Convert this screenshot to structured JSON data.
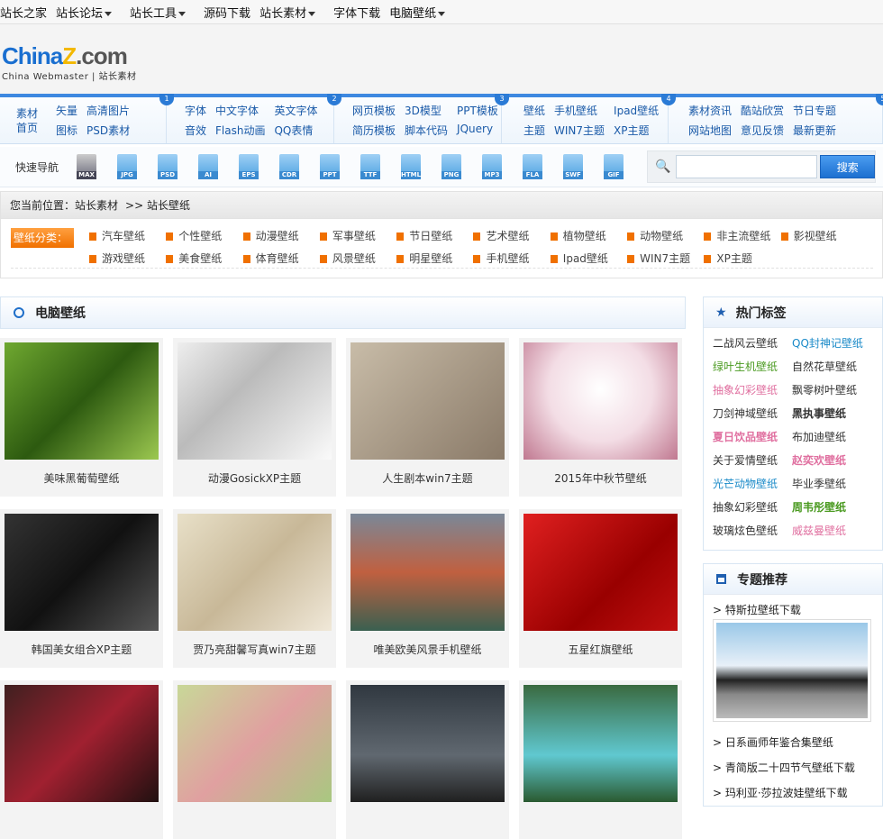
{
  "topnav": [
    "站长之家",
    "站长论坛",
    "站长工具",
    "源码下载",
    "站长素材",
    "字体下载",
    "电脑壁纸"
  ],
  "topnav_dropdown": [
    false,
    true,
    true,
    false,
    true,
    false,
    true
  ],
  "logo": {
    "text": "ChinaZ.com",
    "sub": "China Webmaster | 站长素材"
  },
  "nav_groups": [
    {
      "num": "1",
      "links": [
        "素材首页"
      ],
      "extra": [
        "矢量",
        "高清图片",
        "图标",
        "PSD素材"
      ]
    },
    {
      "num": "2",
      "links": [
        "字体",
        "中文字体",
        "英文字体",
        "音效",
        "Flash动画",
        "QQ表情"
      ]
    },
    {
      "num": "3",
      "links": [
        "网页模板",
        "3D模型",
        "PPT模板",
        "简历模板",
        "脚本代码",
        "JQuery"
      ]
    },
    {
      "num": "4",
      "links": [
        "壁纸",
        "手机壁纸",
        "Ipad壁纸",
        "主题",
        "WIN7主题",
        "XP主题"
      ]
    },
    {
      "num": "5",
      "links": [
        "素材资讯",
        "酷站欣赏",
        "节日专题",
        "网站地图",
        "意见反馈",
        "最新更新"
      ]
    }
  ],
  "quick": {
    "label": "快速导航",
    "icons": [
      "MAX",
      "JPG",
      "PSD",
      "AI",
      "EPS",
      "CDR",
      "PPT",
      "TTF",
      "HTML",
      "PNG",
      "MP3",
      "FLA",
      "SWF",
      "GIF"
    ],
    "search_placeholder": "",
    "search_button": "搜索"
  },
  "breadcrumb": {
    "prefix": "您当前位置：",
    "items": [
      "站长素材",
      ">> 站长壁纸"
    ]
  },
  "categories": {
    "label": "壁纸分类：",
    "items": [
      "汽车壁纸",
      "个性壁纸",
      "动漫壁纸",
      "军事壁纸",
      "节日壁纸",
      "艺术壁纸",
      "植物壁纸",
      "动物壁纸",
      "非主流壁纸",
      "影视壁纸",
      "游戏壁纸",
      "美食壁纸",
      "体育壁纸",
      "风景壁纸",
      "明星壁纸",
      "手机壁纸",
      "Ipad壁纸",
      "WIN7主题",
      "XP主题"
    ]
  },
  "section_title": "电脑壁纸",
  "cards": [
    {
      "title": "美味黑葡萄壁纸",
      "bg": "linear-gradient(135deg,#6fa830,#2d5a10 50%,#9cc850)"
    },
    {
      "title": "动漫GosickXP主题",
      "bg": "linear-gradient(135deg,#eee,#bbb 40%,#fafafa)"
    },
    {
      "title": "人生剧本win7主题",
      "bg": "linear-gradient(135deg,#c8bca8,#8a7a68)"
    },
    {
      "title": "2015年中秋节壁纸",
      "bg": "radial-gradient(circle at 50% 40%,#fff,#f3dde5 50%,#c07890)"
    },
    {
      "title": "韩国美女组合XP主题",
      "bg": "linear-gradient(135deg,#333,#111 50%,#555)"
    },
    {
      "title": "贾乃亮甜馨写真win7主题",
      "bg": "linear-gradient(135deg,#e8e0c8,#c8b898 50%,#f0e8d8)"
    },
    {
      "title": "唯美欧美风景手机壁纸",
      "bg": "linear-gradient(#7a8898,#c06040 50%,#3a6050)"
    },
    {
      "title": "五星红旗壁纸",
      "bg": "linear-gradient(135deg,#e02020,#900 60%,#c01010)"
    },
    {
      "title": "",
      "bg": "linear-gradient(135deg,#402020,#a02030 50%,#201010)"
    },
    {
      "title": "",
      "bg": "linear-gradient(135deg,#c8d898,#e0a0a0 50%,#a8c880)"
    },
    {
      "title": "",
      "bg": "linear-gradient(#303840,#606870 60%,#202020)"
    },
    {
      "title": "",
      "bg": "linear-gradient(#3a6a40,#60c8d0 60%,#2a5a30)"
    }
  ],
  "hot_tags": {
    "title": "热门标签",
    "items": [
      {
        "t": "二战风云壁纸",
        "c": "#333",
        "b": false
      },
      {
        "t": "QQ封神记壁纸",
        "c": "#1a8ac8",
        "b": false
      },
      {
        "t": "绿叶生机壁纸",
        "c": "#4a9a20",
        "b": false
      },
      {
        "t": "自然花草壁纸",
        "c": "#333",
        "b": false
      },
      {
        "t": "抽象幻彩壁纸",
        "c": "#e070a0",
        "b": false
      },
      {
        "t": "飘零树叶壁纸",
        "c": "#333",
        "b": false
      },
      {
        "t": "刀剑神域壁纸",
        "c": "#333",
        "b": false
      },
      {
        "t": "黑执事壁纸",
        "c": "#333",
        "b": true
      },
      {
        "t": "夏日饮品壁纸",
        "c": "#e070a0",
        "b": true
      },
      {
        "t": "布加迪壁纸",
        "c": "#333",
        "b": false
      },
      {
        "t": "关于爱情壁纸",
        "c": "#333",
        "b": false
      },
      {
        "t": "赵奕欢壁纸",
        "c": "#e070a0",
        "b": true
      },
      {
        "t": "光芒动物壁纸",
        "c": "#1a8ac8",
        "b": false
      },
      {
        "t": "毕业季壁纸",
        "c": "#333",
        "b": false
      },
      {
        "t": "抽象幻彩壁纸",
        "c": "#333",
        "b": false
      },
      {
        "t": "周韦彤壁纸",
        "c": "#4a9a20",
        "b": true
      },
      {
        "t": "玻璃炫色壁纸",
        "c": "#333",
        "b": false
      },
      {
        "t": "威兹曼壁纸",
        "c": "#e070a0",
        "b": false
      }
    ]
  },
  "special": {
    "title": "专题推荐",
    "items": [
      "> 特斯拉壁纸下载",
      "> 日系画师年鉴合集壁纸",
      "> 青简版二十四节气壁纸下载",
      "> 玛利亚·莎拉波娃壁纸下载"
    ]
  }
}
